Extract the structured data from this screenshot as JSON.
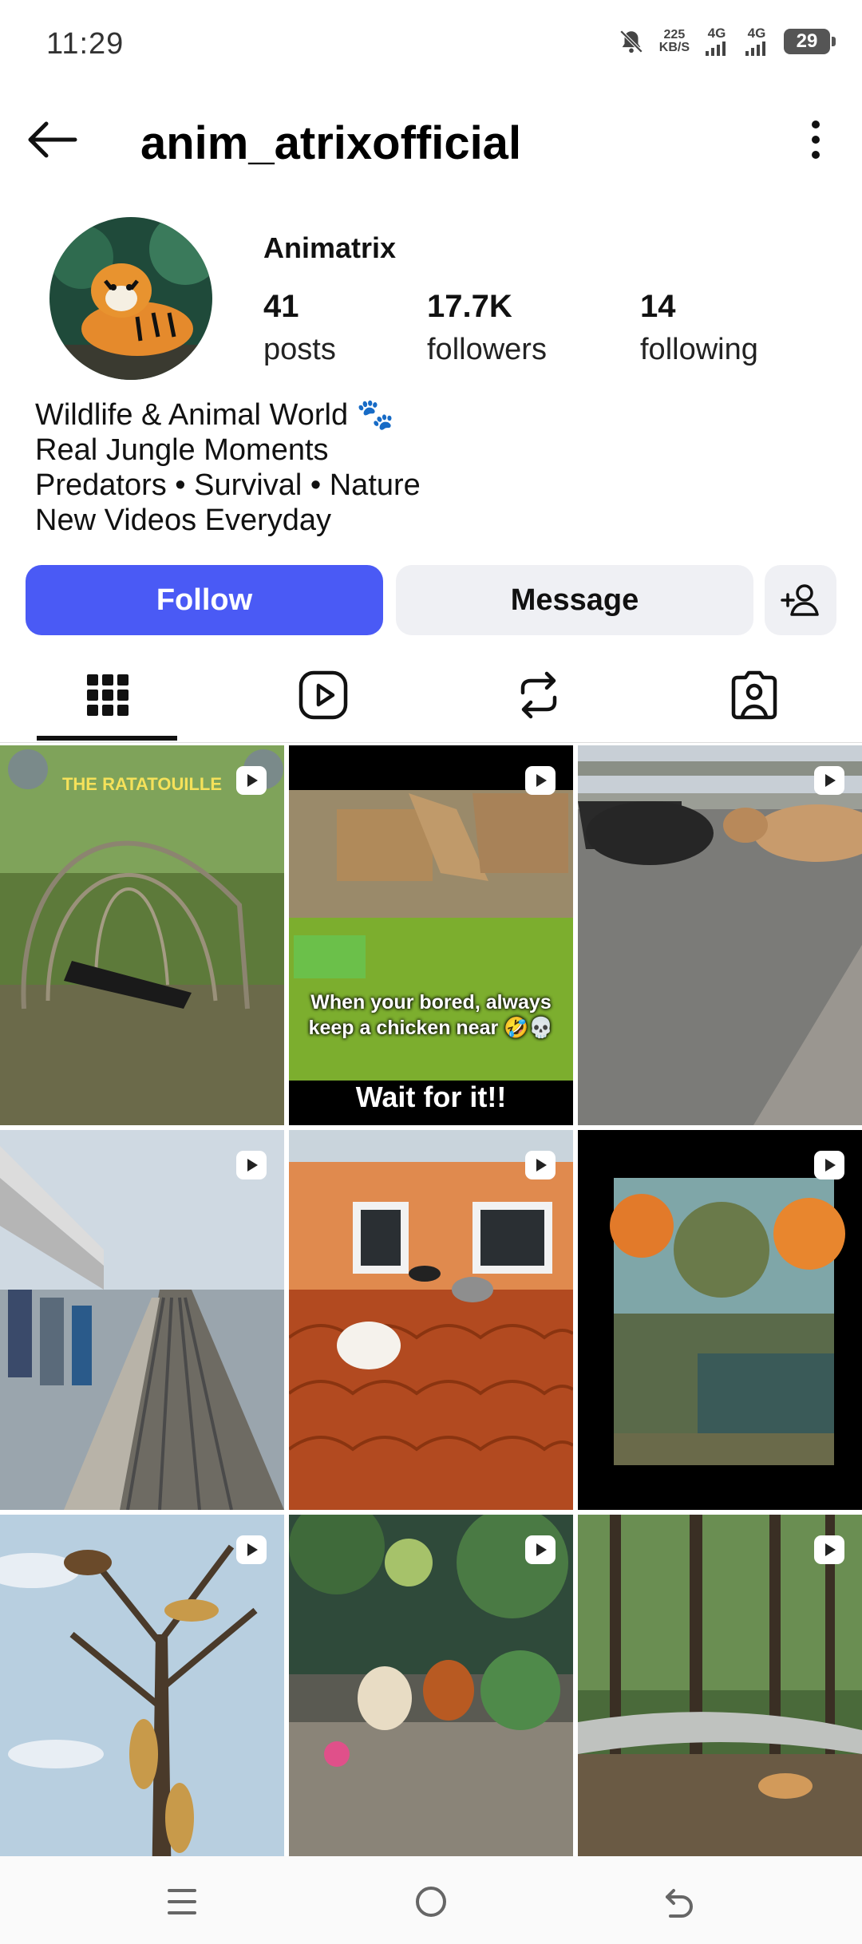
{
  "status": {
    "time": "11:29",
    "speed_value": "225",
    "speed_unit": "KB/S",
    "net1": "4G",
    "net2": "4G",
    "battery": "29"
  },
  "header": {
    "username": "anim_atrixofficial"
  },
  "profile": {
    "display_name": "Animatrix",
    "posts_count": "41",
    "posts_label": "posts",
    "followers_count": "17.7K",
    "followers_label": "followers",
    "following_count": "14",
    "following_label": "following",
    "bio": [
      "Wildlife & Animal World 🐾",
      "Real Jungle Moments",
      "Predators • Survival • Nature",
      "New Videos Everyday"
    ]
  },
  "actions": {
    "follow_label": "Follow",
    "message_label": "Message"
  },
  "tabs": [
    {
      "icon": "grid-icon",
      "selected": true
    },
    {
      "icon": "reels-icon",
      "selected": false
    },
    {
      "icon": "reposts-icon",
      "selected": false
    },
    {
      "icon": "tagged-icon",
      "selected": false
    }
  ],
  "posts": [
    {
      "overlay": "THE RATATOUILLE"
    },
    {
      "overlay_caption": "When your bored, always keep a chicken near 🤣💀",
      "overlay_footer": "Wait for it!!"
    },
    {},
    {},
    {},
    {},
    {},
    {},
    {}
  ],
  "colors": {
    "accent": "#4a5af5",
    "button_gray": "#eff0f4"
  }
}
